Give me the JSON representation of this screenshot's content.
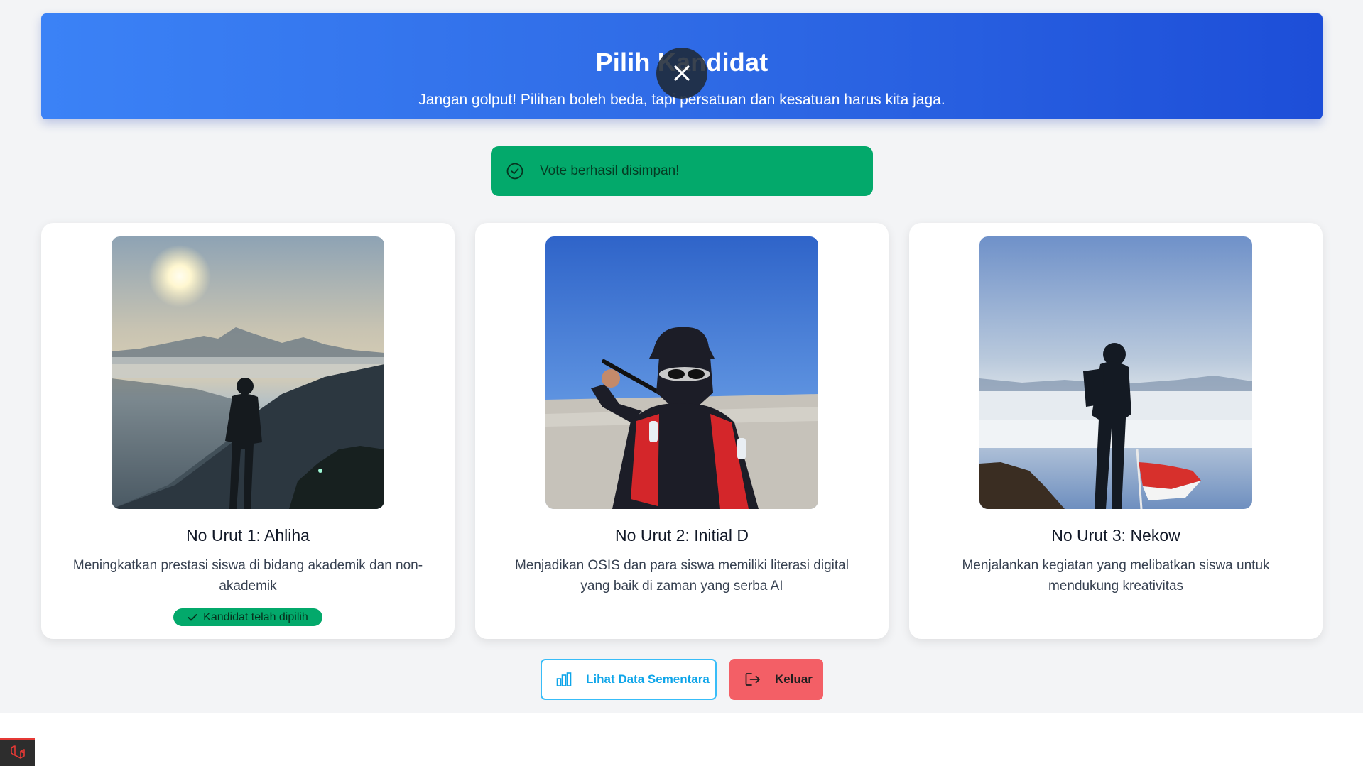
{
  "header": {
    "title": "Pilih Kandidat",
    "subtitle": "Jangan golput! Pilihan boleh beda, tapi persatuan dan kesatuan harus kita jaga."
  },
  "toast": {
    "message": "Vote berhasil disimpan!",
    "color": "#03a96b"
  },
  "candidates": [
    {
      "name": "No Urut 1: Ahliha",
      "description": "Meningkatkan prestasi siswa di bidang akademik dan non-akademik",
      "badge": "Kandidat telah dipilih",
      "photo": "mountain-sunrise-silhouette"
    },
    {
      "name": "No Urut 2: Initial D",
      "description": "Menjadikan OSIS dan para siswa memiliki literasi digital yang baik di zaman yang serba AI",
      "photo": "hiker-blue-sky"
    },
    {
      "name": "No Urut 3: Nekow",
      "description": "Menjalankan kegiatan yang melibatkan siswa untuk mendukung kreativitas",
      "photo": "hiker-sea-of-clouds-flag"
    }
  ],
  "buttons": {
    "data_label": "Lihat Data Sementara",
    "logout_label": "Keluar"
  },
  "colors": {
    "primary": "#2563eb",
    "success": "#03a96b",
    "danger": "#f35f66",
    "info": "#0ea5e9"
  },
  "icons": [
    "close-icon",
    "check-circle-icon",
    "check-icon",
    "bar-chart-icon",
    "logout-icon",
    "laravel-icon"
  ]
}
